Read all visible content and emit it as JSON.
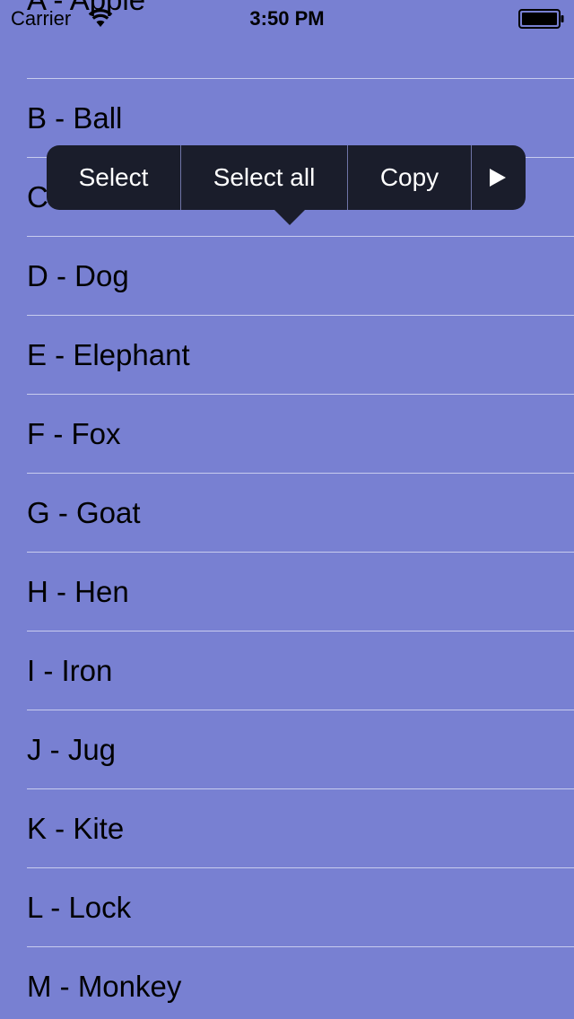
{
  "status_bar": {
    "carrier": "Carrier",
    "time": "3:50 PM",
    "wifi_icon": "wifi-icon",
    "battery_icon": "battery-icon"
  },
  "list": {
    "items": [
      {
        "label": "A - Apple"
      },
      {
        "label": "B - Ball"
      },
      {
        "label": "C - Cat"
      },
      {
        "label": "D - Dog"
      },
      {
        "label": "E - Elephant"
      },
      {
        "label": "F - Fox"
      },
      {
        "label": "G - Goat"
      },
      {
        "label": "H - Hen"
      },
      {
        "label": "I - Iron"
      },
      {
        "label": "J - Jug"
      },
      {
        "label": "K - Kite"
      },
      {
        "label": "L - Lock"
      },
      {
        "label": "M - Monkey"
      }
    ]
  },
  "edit_menu": {
    "select_label": "Select",
    "select_all_label": "Select all",
    "copy_label": "Copy",
    "more_icon": "play-triangle-icon"
  },
  "colors": {
    "background": "#7880d2",
    "separator": "#c8ccee",
    "menu_background": "#1a1d2b",
    "menu_text": "#ffffff"
  }
}
